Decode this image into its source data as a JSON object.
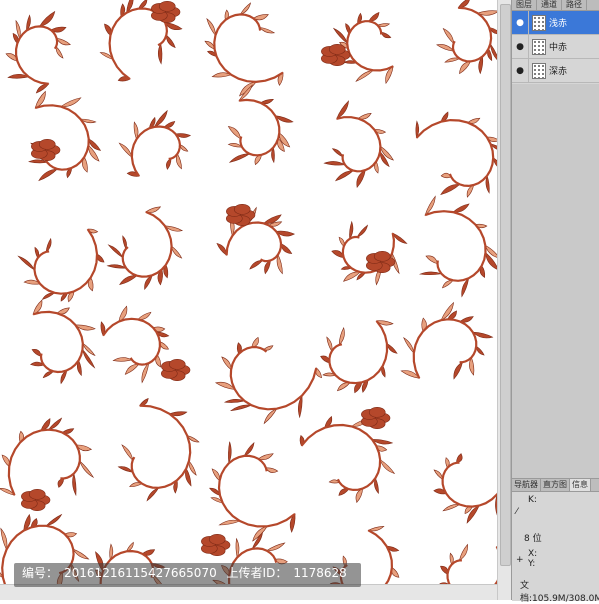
{
  "watermark": {
    "id_label": "编号：",
    "id_value": "20161216115427665070",
    "uploader_label": "上传者ID：",
    "uploader_value": "1178628"
  },
  "layers_panel": {
    "tabs": [
      "图层",
      "通道",
      "路径"
    ],
    "layers": [
      {
        "name": "浅赤",
        "selected": true
      },
      {
        "name": "中赤",
        "selected": false
      },
      {
        "name": "深赤",
        "selected": false
      }
    ]
  },
  "info_panel": {
    "tabs": [
      "导航器",
      "直方图",
      "信息"
    ],
    "k_label": "K:",
    "bit_label": "8 位",
    "x_label": "X:",
    "y_label": "Y:",
    "doc_label": "文档:105.9M/308.0M"
  },
  "colors": {
    "pattern_main": "#b5482b",
    "pattern_light": "#e7a07e",
    "pattern_dark": "#7e2a16",
    "selection_blue": "#3b78d8"
  }
}
